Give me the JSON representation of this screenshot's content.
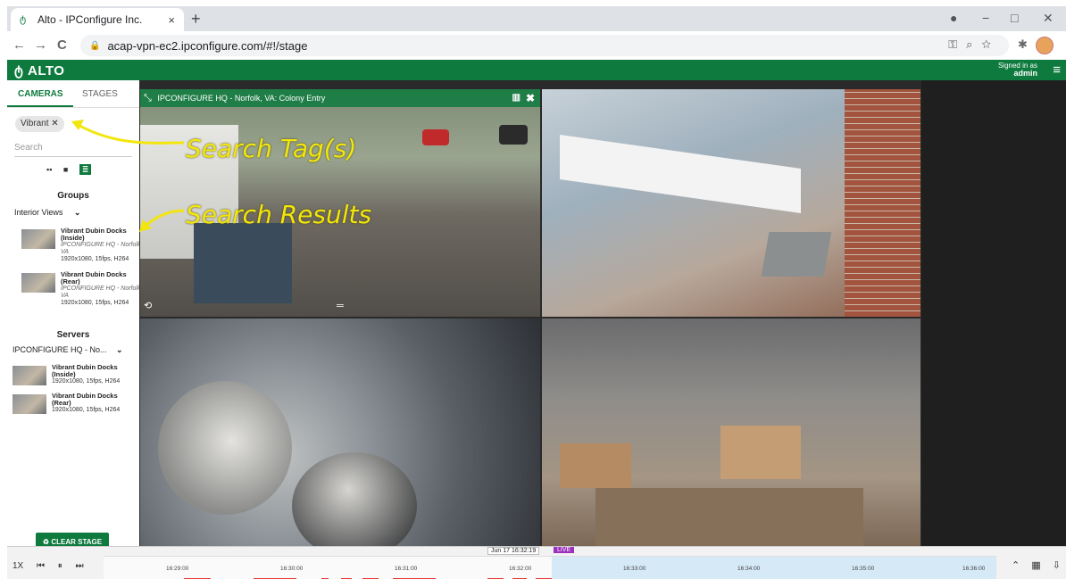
{
  "browser": {
    "tab_title": "Alto - IPConfigure Inc.",
    "tab_close": "×",
    "new_tab": "+",
    "url": "acap-vpn-ec2.ipconfigure.com/#!/stage",
    "back": "←",
    "forward": "→",
    "reload": "C",
    "window": {
      "record": "●",
      "minimize": "−",
      "restore": "□",
      "close": "✕"
    }
  },
  "app": {
    "logo": "ALTO",
    "signed_in_label": "Signed in as",
    "user": "admin",
    "brand_color": "#0e7a3e"
  },
  "sidebar": {
    "tabs": [
      "CAMERAS",
      "STAGES"
    ],
    "tag": "Vibrant",
    "search_placeholder": "Search",
    "groups_title": "Groups",
    "groups_dropdown": "Interior Views",
    "group_results": [
      {
        "name": "Vibrant Dubin Docks (Inside)",
        "location": "IPCONFIGURE HQ - Norfolk, VA",
        "specs": "1920x1080, 15fps, H264"
      },
      {
        "name": "Vibrant Dubin Docks (Rear)",
        "location": "IPCONFIGURE HQ - Norfolk, VA",
        "specs": "1920x1080, 15fps, H264"
      }
    ],
    "servers_title": "Servers",
    "servers_dropdown": "IPCONFIGURE HQ - No...",
    "server_results": [
      {
        "name": "Vibrant Dubin Docks (Inside)",
        "specs": "1920x1080, 15fps, H264"
      },
      {
        "name": "Vibrant Dubin Docks (Rear)",
        "specs": "1920x1080, 15fps, H264"
      }
    ],
    "clear_stage": "CLEAR STAGE"
  },
  "stage": {
    "active_camera_title": "IPCONFIGURE HQ - Norfolk, VA: Colony Entry"
  },
  "timeline": {
    "speed": "1X",
    "ticks": [
      "16:29:00",
      "16:30:00",
      "16:31:00",
      "16:32:00",
      "16:33:00",
      "16:34:00",
      "16:35:00",
      "16:36:00"
    ],
    "current_time": "Jun 17 16:32:19",
    "live_label": "LIVE",
    "live_color": "#9b2fbf"
  },
  "annotations": {
    "search_tags": "Search Tag(s)",
    "search_results": "Search Results",
    "color": "#f2e60e"
  }
}
